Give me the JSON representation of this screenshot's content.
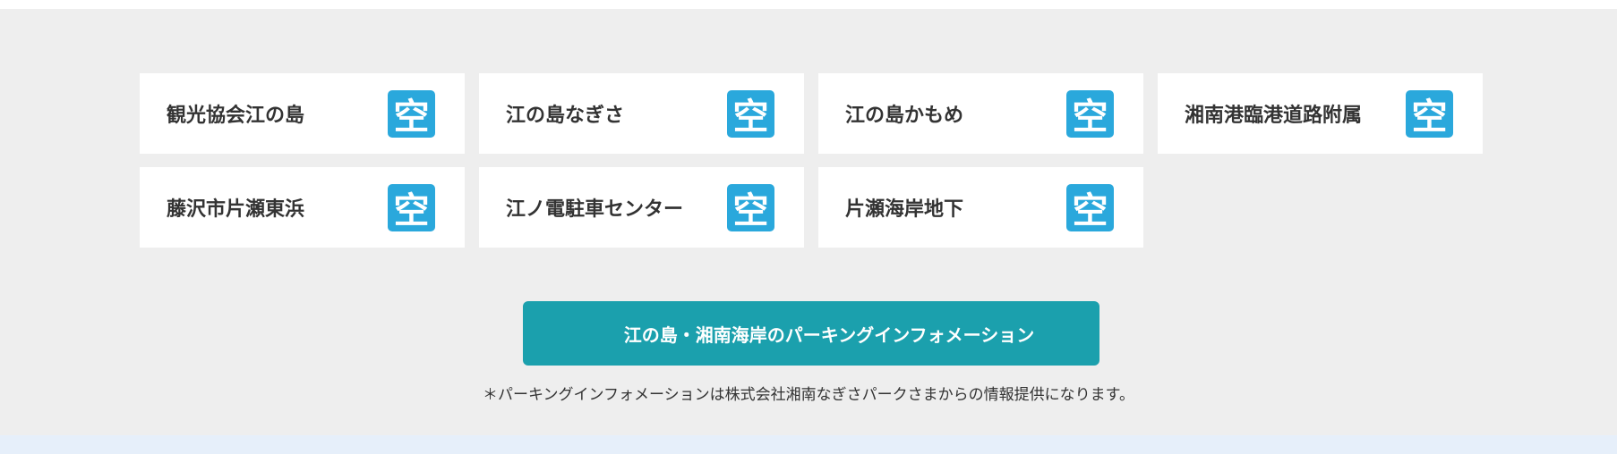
{
  "parking_lots": [
    {
      "name": "観光協会江の島",
      "status": "空",
      "status_icon": "vacant-icon"
    },
    {
      "name": "江の島なぎさ",
      "status": "空",
      "status_icon": "vacant-icon"
    },
    {
      "name": "江の島かもめ",
      "status": "空",
      "status_icon": "vacant-icon"
    },
    {
      "name": "湘南港臨港道路附属",
      "status": "空",
      "status_icon": "vacant-icon"
    },
    {
      "name": "藤沢市片瀬東浜",
      "status": "空",
      "status_icon": "vacant-icon"
    },
    {
      "name": "江ノ電駐車センター",
      "status": "空",
      "status_icon": "vacant-icon"
    },
    {
      "name": "片瀬海岸地下",
      "status": "空",
      "status_icon": "vacant-icon"
    }
  ],
  "info_button": {
    "label": "江の島・湘南海岸のパーキングインフォメーション"
  },
  "note": "＊パーキングインフォメーションは株式会社湘南なぎさパークさまからの情報提供になります。",
  "colors": {
    "background": "#eeeeee",
    "card": "#ffffff",
    "vacant_icon": "#2aa8dc",
    "button": "#1ba0ad",
    "text": "#333333"
  }
}
